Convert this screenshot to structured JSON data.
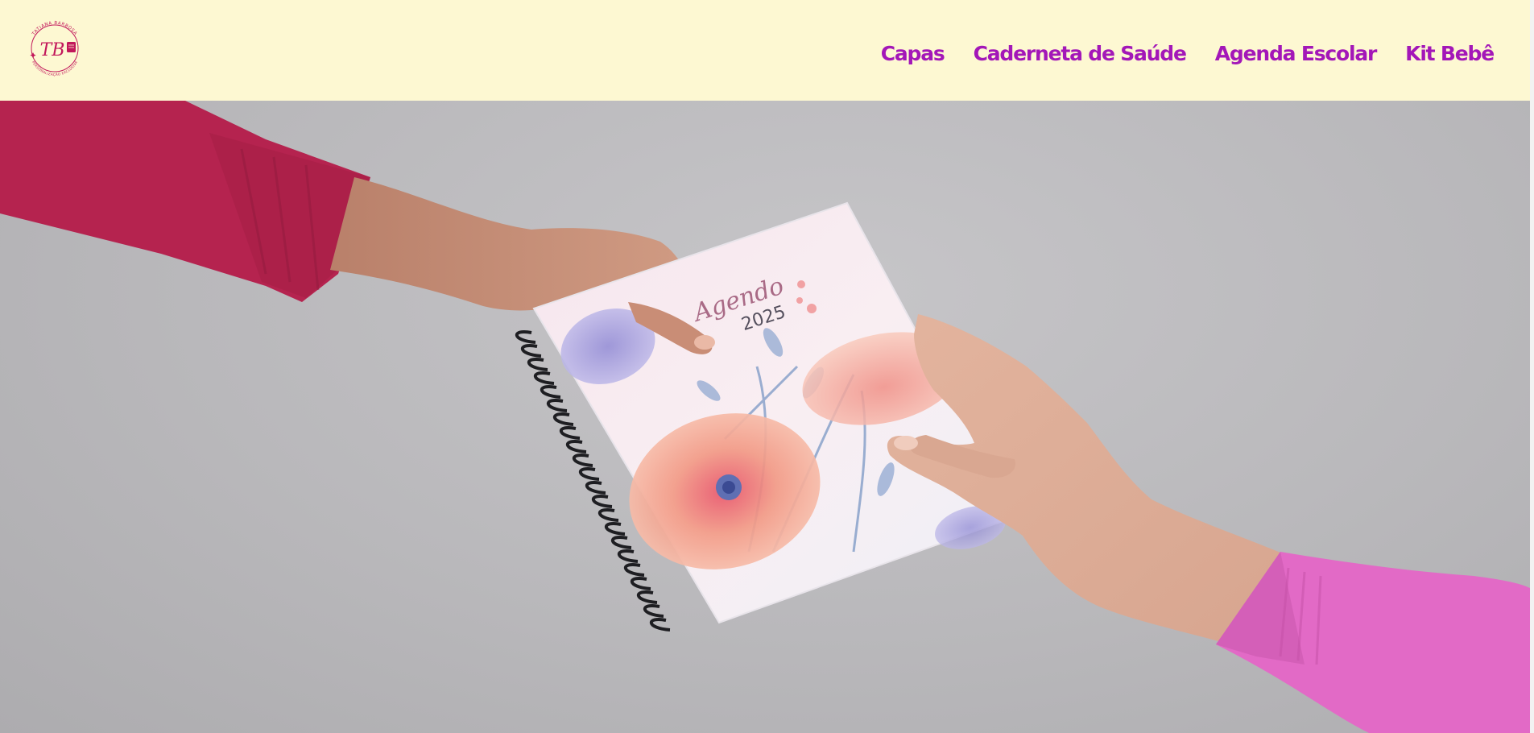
{
  "header": {
    "logo": {
      "monogram": "TB",
      "ring_text_top": "TATIANA BARBOSA",
      "ring_text_bottom": "PERSONALIZAÇÃO EXCLUSIVA",
      "icon": "notebook-icon"
    },
    "nav": [
      {
        "label": "Capas"
      },
      {
        "label": "Caderneta de Saúde"
      },
      {
        "label": "Agenda Escolar"
      },
      {
        "label": "Kit Bebê"
      }
    ]
  },
  "hero": {
    "notebook_title": "Agendo",
    "notebook_year": "2025"
  },
  "colors": {
    "header_bg": "#fdf8d2",
    "nav_text": "#a317b8",
    "logo": "#c2185b",
    "hero_bg": "#bdbcbf",
    "left_sleeve": "#b5234f",
    "right_sleeve": "#e26ac6"
  }
}
